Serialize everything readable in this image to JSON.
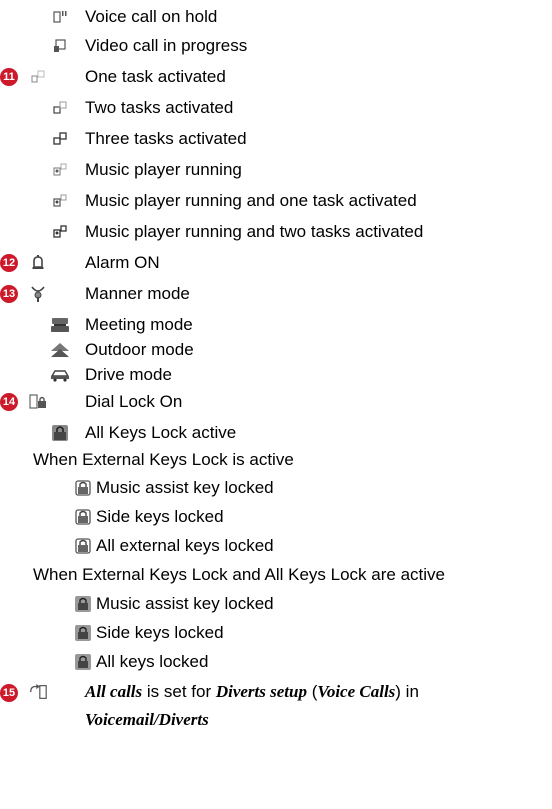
{
  "items": [
    {
      "label": "Voice call on hold",
      "icon": "voice-call-hold-icon"
    },
    {
      "label": "Video call in progress",
      "icon": "video-call-icon"
    },
    {
      "label": "One task activated",
      "icon": "one-task-icon",
      "badge": "11"
    },
    {
      "label": "Two tasks activated",
      "icon": "two-tasks-icon"
    },
    {
      "label": "Three tasks activated",
      "icon": "three-tasks-icon"
    },
    {
      "label": "Music player running",
      "icon": "music-player-icon"
    },
    {
      "label": "Music player running and one task activated",
      "icon": "music-one-task-icon"
    },
    {
      "label": "Music player running and two tasks activated",
      "icon": "music-two-tasks-icon"
    },
    {
      "label": "Alarm ON",
      "icon": "alarm-bell-icon",
      "badge": "12"
    },
    {
      "label": "Manner mode",
      "icon": "manner-mode-icon",
      "badge": "13"
    },
    {
      "label": "Meeting mode",
      "icon": "meeting-mode-icon"
    },
    {
      "label": "Outdoor mode",
      "icon": "outdoor-mode-icon"
    },
    {
      "label": "Drive mode",
      "icon": "drive-mode-icon"
    },
    {
      "label": "Dial Lock On",
      "icon": "dial-lock-icon",
      "badge": "14"
    },
    {
      "label": "All Keys Lock active",
      "icon": "all-keys-lock-icon"
    }
  ],
  "external_section": {
    "heading": "When External Keys Lock is active",
    "items": [
      {
        "label": "Music assist key locked",
        "icon": "music-key-lock-icon"
      },
      {
        "label": "Side keys locked",
        "icon": "side-key-lock-icon"
      },
      {
        "label": "All external keys locked",
        "icon": "external-keys-lock-icon"
      }
    ]
  },
  "both_section": {
    "heading": "When External Keys Lock and All Keys Lock are active",
    "items": [
      {
        "label": "Music assist key locked",
        "icon": "music-key-lock-all-icon"
      },
      {
        "label": "Side keys locked",
        "icon": "side-key-lock-all-icon"
      },
      {
        "label": "All keys locked",
        "icon": "all-keys-locked-icon"
      }
    ]
  },
  "divert": {
    "badge": "15",
    "icon": "divert-all-calls-icon",
    "line1_bold1": "All calls",
    "line1_plain1": " is set for ",
    "line1_bold2": "Diverts setup",
    "line1_plain2": " (",
    "line1_bold3": "Voice Calls",
    "line1_plain3": ") in",
    "line2_bold": "Voicemail/Diverts"
  },
  "colors": {
    "badge": "#cc1a2b",
    "icon": "#555555"
  }
}
